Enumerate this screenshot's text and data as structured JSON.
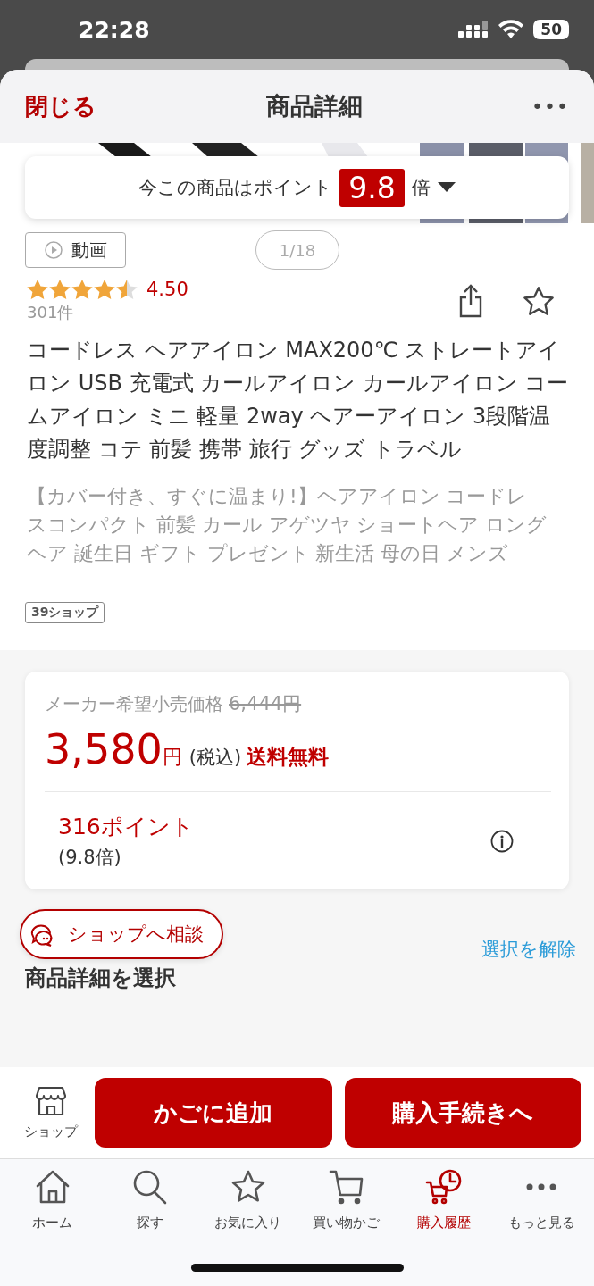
{
  "status_bar": {
    "time": "22:28",
    "battery": "50"
  },
  "header": {
    "close": "閉じる",
    "title": "商品詳細",
    "more": "•••"
  },
  "gallery": {
    "kind": "picture",
    "points_banner": {
      "text": "今この商品はポイント",
      "multiplier": "9.8",
      "suffix": "倍"
    },
    "video_button": "動画",
    "pager": "1/18"
  },
  "rating": {
    "stars": 4.5,
    "score": "4.50",
    "count": "301件"
  },
  "product_title": "コードレス ヘアアイロン MAX200℃ ストレートアイロン USB 充電式 カールアイロン カールアイロン コームアイロン ミニ 軽量 2way ヘアーアイロン 3段階温度調整 コテ 前髪 携帯 旅行 グッズ トラベル",
  "catch_copy": "【カバー付き、すぐに温まり!】ヘアアイロン コードレスコンパクト 前髪 カール アゲツヤ  ショートヘア ロングヘア 誕生日 ギフト プレゼント 新生活 母の日 メンズ",
  "shop_tag": "39ショップ",
  "price_card": {
    "list_label": "メーカー希望小売価格",
    "list_price": "6,444円",
    "price": "3,580",
    "yen": "円",
    "tax": "(税込)",
    "shipping": "送料無料",
    "points": "316ポイント",
    "points_rate": "(9.8倍)"
  },
  "consult_button": "ショップへ相談",
  "section_heading": "商品詳細を選択",
  "clear_link": "選択を解除",
  "action_bar": {
    "shop": "ショップ",
    "add_to_cart": "かごに追加",
    "checkout": "購入手続きへ"
  },
  "tabs": [
    {
      "label": "ホーム",
      "kind": "home",
      "selected": false
    },
    {
      "label": "探す",
      "kind": "search",
      "selected": false
    },
    {
      "label": "お気に入り",
      "kind": "favorites",
      "selected": false
    },
    {
      "label": "買い物かご",
      "kind": "cart",
      "selected": false
    },
    {
      "label": "購入履歴",
      "kind": "history",
      "selected": true
    },
    {
      "label": "もっと見る",
      "kind": "more",
      "selected": false
    }
  ]
}
